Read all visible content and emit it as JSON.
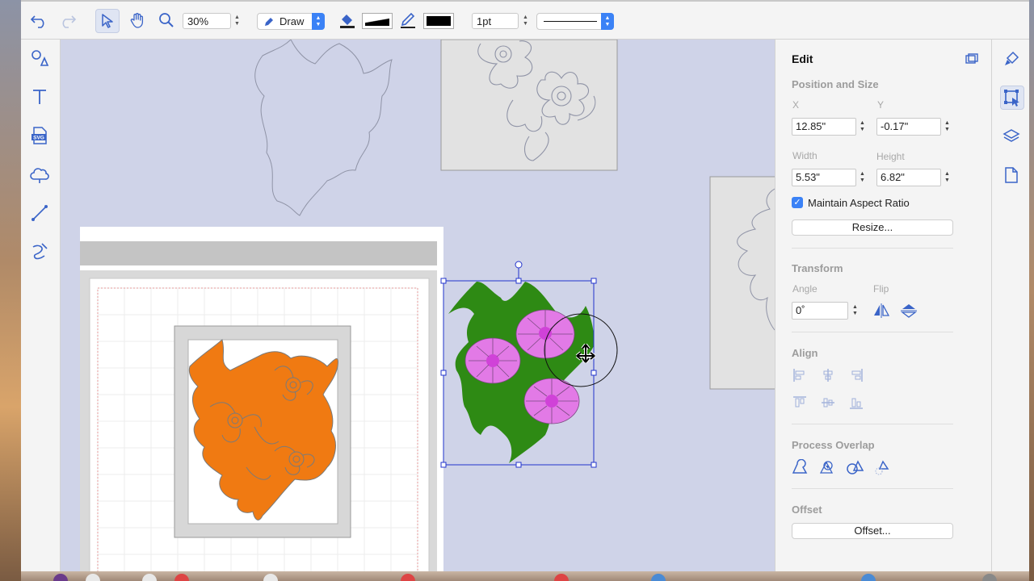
{
  "toolbar": {
    "zoom_value": "30%",
    "mode_label": "Draw",
    "stroke_width_value": "1pt",
    "colors": {
      "accent": "#3b82f6",
      "icon": "#3a64c8"
    }
  },
  "left_tools": [
    {
      "name": "shapes-tool-icon"
    },
    {
      "name": "text-tool-icon"
    },
    {
      "name": "svg-import-icon",
      "badge": "SVG"
    },
    {
      "name": "cloud-shape-icon"
    },
    {
      "name": "line-tool-icon"
    },
    {
      "name": "pen-tool-icon"
    }
  ],
  "panel": {
    "title": "Edit",
    "position_size": {
      "heading": "Position and Size",
      "x_label": "X",
      "x_value": "12.85\"",
      "y_label": "Y",
      "y_value": "-0.17\"",
      "width_label": "Width",
      "width_value": "5.53\"",
      "height_label": "Height",
      "height_value": "6.82\"",
      "aspect_label": "Maintain Aspect Ratio",
      "aspect_checked": true,
      "resize_button": "Resize..."
    },
    "transform": {
      "heading": "Transform",
      "angle_label": "Angle",
      "angle_value": "0˚",
      "flip_label": "Flip"
    },
    "align": {
      "heading": "Align"
    },
    "process_overlap": {
      "heading": "Process Overlap"
    },
    "offset": {
      "heading": "Offset",
      "button": "Offset..."
    }
  },
  "design_colors": {
    "orange": "#f07a12",
    "pink": "#e27ae6",
    "green": "#2e8a14",
    "handle": "#2233cc"
  }
}
